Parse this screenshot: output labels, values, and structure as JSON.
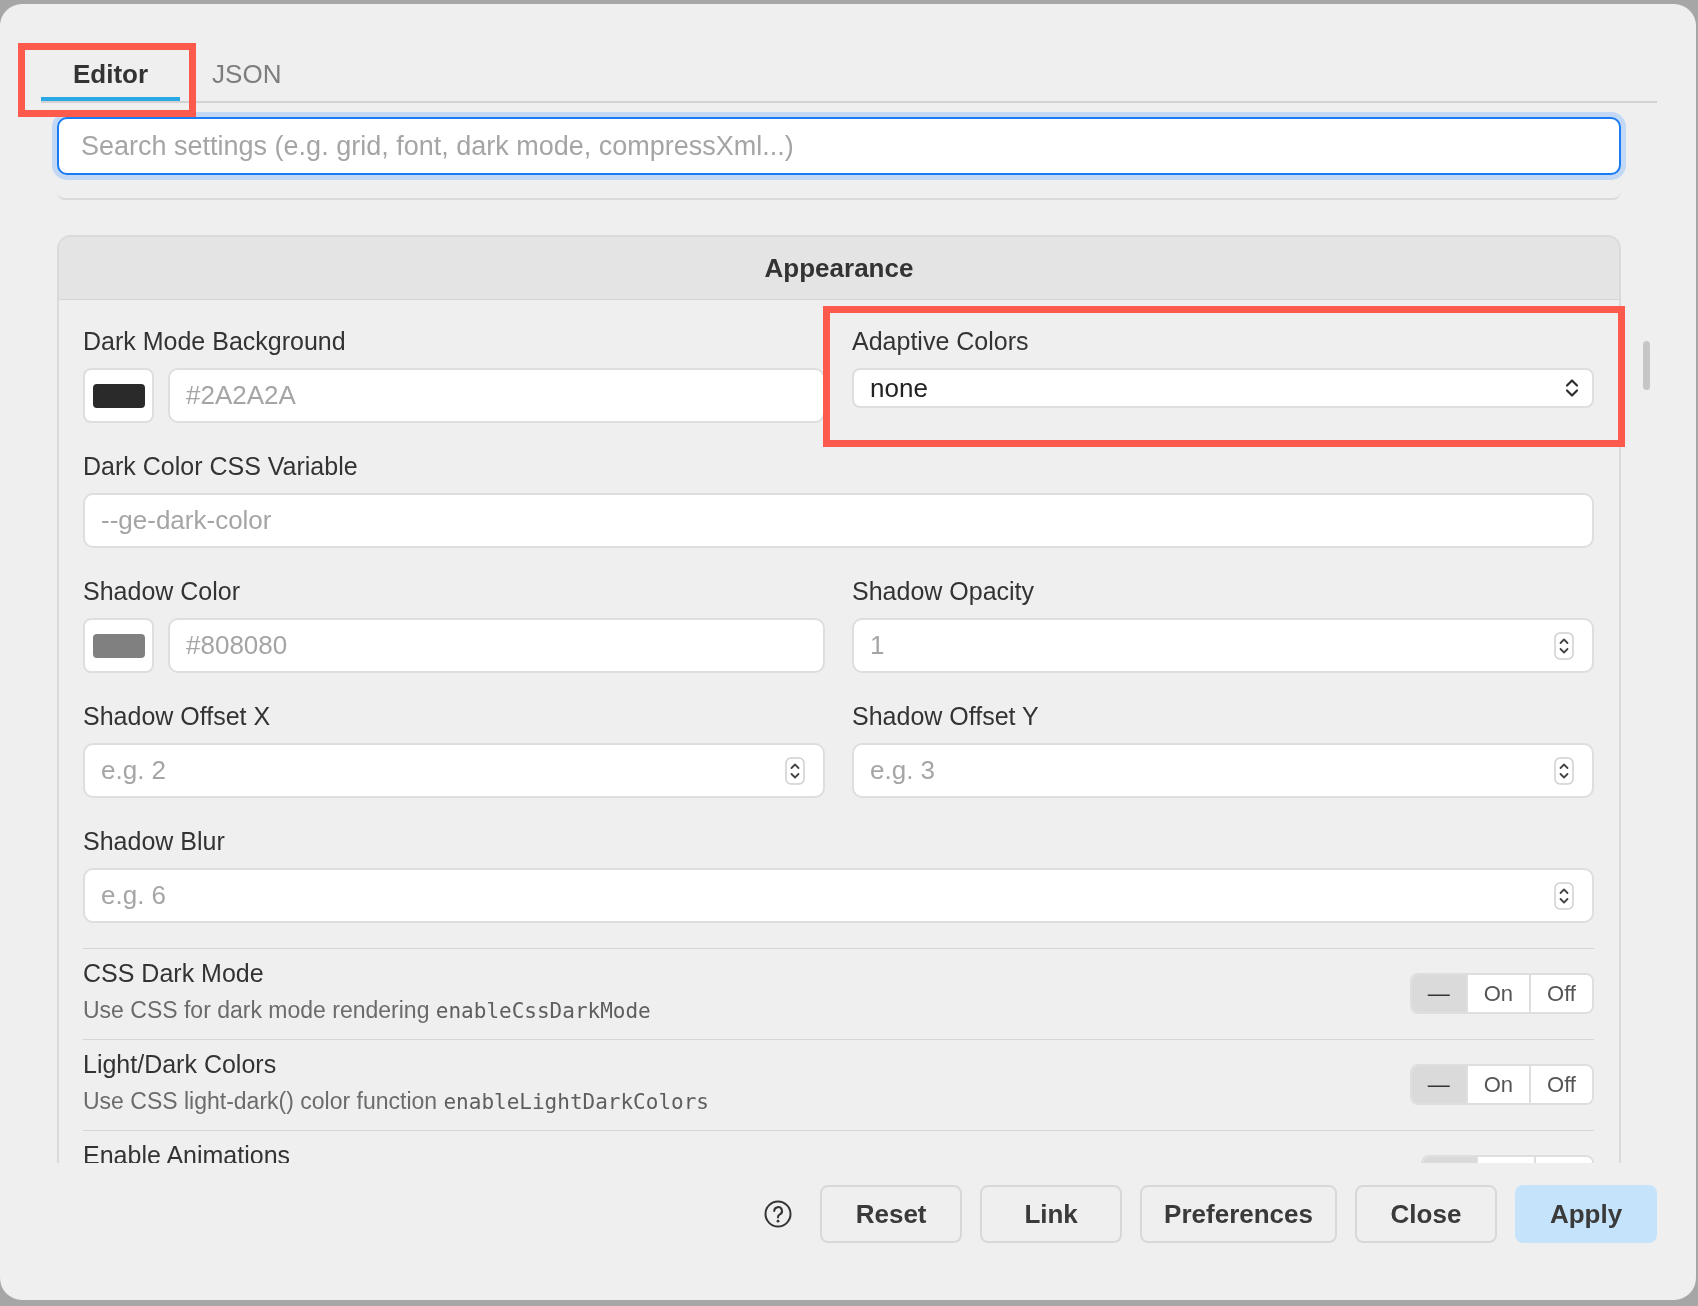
{
  "tabs": [
    {
      "label": "Editor",
      "selected": true,
      "highlighted": true
    },
    {
      "label": "JSON",
      "selected": false,
      "highlighted": false
    }
  ],
  "search": {
    "placeholder": "Search settings (e.g. grid, font, dark mode, compressXml...)",
    "focused": true
  },
  "section": {
    "title": "Appearance",
    "rows": [
      {
        "fields": [
          {
            "kind": "color",
            "label": "Dark Mode Background",
            "color": "#2a2a2a",
            "placeholder": "#2A2A2A",
            "highlighted": false
          },
          {
            "kind": "select",
            "label": "Adaptive Colors",
            "value": "none",
            "highlighted": true
          }
        ]
      },
      {
        "fields": [
          {
            "kind": "text",
            "label": "Dark Color CSS Variable",
            "placeholder": "--ge-dark-color",
            "highlighted": false
          }
        ]
      },
      {
        "fields": [
          {
            "kind": "color",
            "label": "Shadow Color",
            "color": "#808080",
            "placeholder": "#808080",
            "highlighted": false
          },
          {
            "kind": "number",
            "label": "Shadow Opacity",
            "placeholder": "1",
            "highlighted": false
          }
        ]
      },
      {
        "fields": [
          {
            "kind": "number",
            "label": "Shadow Offset X",
            "placeholder": "e.g. 2",
            "highlighted": false
          },
          {
            "kind": "number",
            "label": "Shadow Offset Y",
            "placeholder": "e.g. 3",
            "highlighted": false
          }
        ]
      },
      {
        "fields": [
          {
            "kind": "number",
            "label": "Shadow Blur",
            "placeholder": "e.g. 6",
            "highlighted": false
          }
        ]
      }
    ],
    "toggles": [
      {
        "label": "CSS Dark Mode",
        "description": "Use CSS for dark mode rendering",
        "setting_key": "enableCssDarkMode",
        "options": [
          {
            "label": "—",
            "selected": true
          },
          {
            "label": "On",
            "selected": false
          },
          {
            "label": "Off",
            "selected": false
          }
        ]
      },
      {
        "label": "Light/Dark Colors",
        "description": "Use CSS light-dark() color function",
        "setting_key": "enableLightDarkColors",
        "options": [
          {
            "label": "—",
            "selected": true
          },
          {
            "label": "On",
            "selected": false
          },
          {
            "label": "Off",
            "selected": false
          }
        ]
      },
      {
        "label": "Enable Animations",
        "options": [
          {
            "selected": true
          },
          {
            "selected": false
          },
          {
            "selected": false
          }
        ]
      }
    ]
  },
  "buttons": [
    {
      "label": "Reset",
      "kind": "default"
    },
    {
      "label": "Link",
      "kind": "default"
    },
    {
      "label": "Preferences",
      "kind": "default"
    },
    {
      "label": "Close",
      "kind": "default"
    },
    {
      "label": "Apply",
      "kind": "primary"
    }
  ]
}
